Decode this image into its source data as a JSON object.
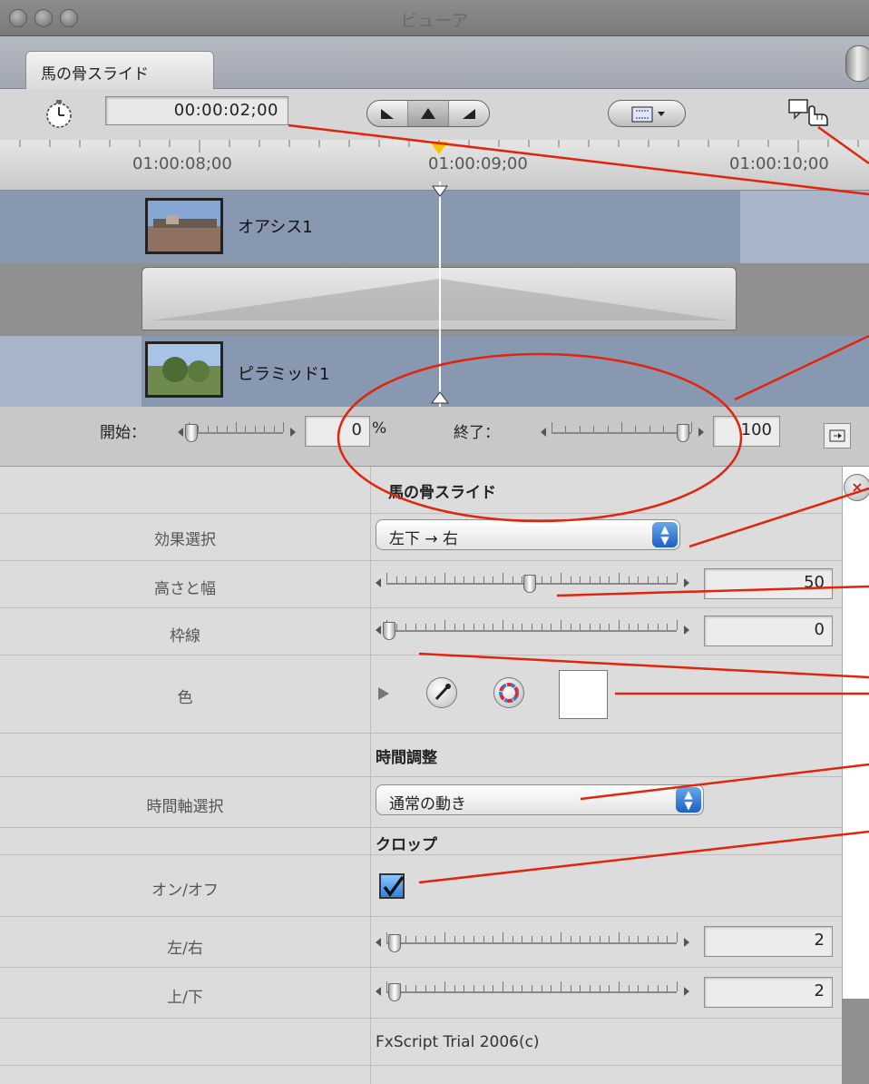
{
  "window": {
    "title": "ビューア",
    "tab_label": "馬の骨スライド"
  },
  "toolbar": {
    "timecode": "00:00:02;00"
  },
  "ruler": {
    "labels": [
      "01:00:08;00",
      "01:00:09;00",
      "01:00:10;00"
    ]
  },
  "tracks": {
    "clip_a": "オアシス1",
    "clip_b": "ピラミッド1"
  },
  "transition": {
    "start_label": "開始：",
    "start_value": "0",
    "start_unit": "%",
    "end_label": "終了：",
    "end_value": "100"
  },
  "params": {
    "header": "馬の骨スライド",
    "effect_label": "効果選択",
    "effect_value": "左下 → 右",
    "size_label": "高さと幅",
    "size_value": "50",
    "border_label": "枠線",
    "border_value": "0",
    "color_label": "色",
    "time_section": "時間調整",
    "time_label": "時間軸選択",
    "time_value": "通常の動き",
    "crop_section": "クロップ",
    "onoff_label": "オン/オフ",
    "lr_label": "左/右",
    "lr_value": "2",
    "tb_label": "上/下",
    "tb_value": "2",
    "footer": "FxScript Trial 2006(c)"
  },
  "sliders": {
    "start_fraction": 0.0,
    "end_fraction": 1.0,
    "size_fraction": 0.5,
    "border_fraction": 0.0,
    "lr_fraction": 0.02,
    "tb_fraction": 0.02
  },
  "colors": {
    "annotation": "#e0250c",
    "track": "#8998b1",
    "accent": "#1d5fc4"
  },
  "icons": [
    "stopwatch-icon",
    "playhead-icon",
    "hand-pointer-icon",
    "eyedropper-icon",
    "color-wheel-icon",
    "close-icon",
    "checkmark-icon"
  ]
}
